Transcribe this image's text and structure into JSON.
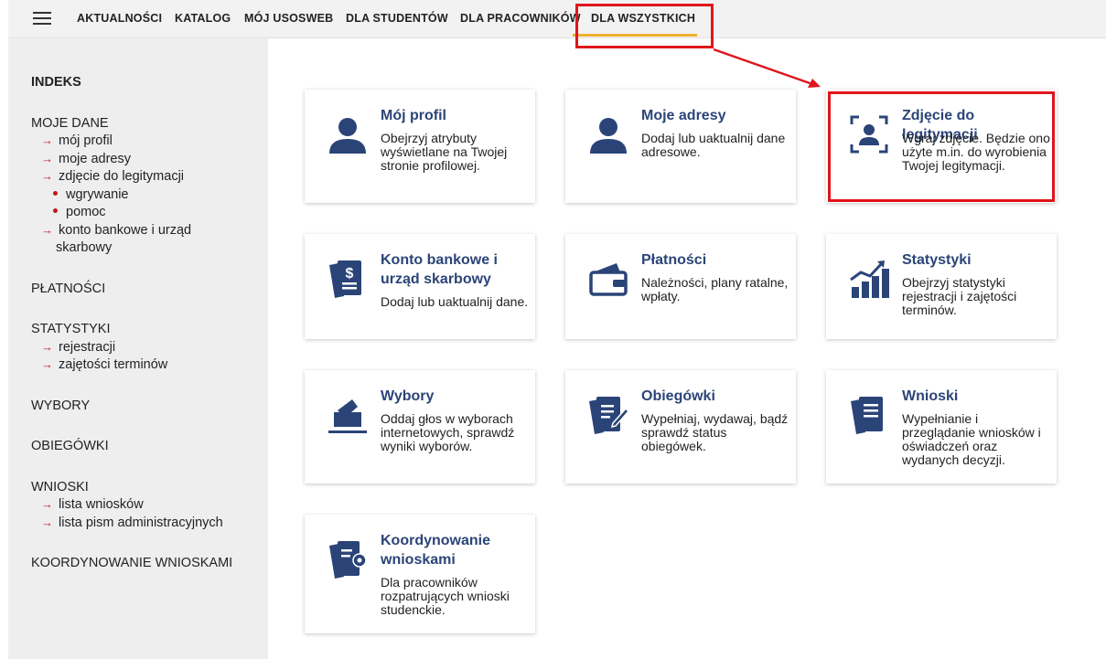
{
  "nav": {
    "items": [
      "AKTUALNOŚCI",
      "KATALOG",
      "MÓJ USOSWEB",
      "DLA STUDENTÓW",
      "DLA PRACOWNIKÓW",
      "DLA WSZYSTKICH"
    ]
  },
  "sidebar": {
    "indeks": "INDEKS",
    "moje_dane": "MOJE DANE",
    "moj_profil": "mój profil",
    "moje_adresy": "moje adresy",
    "zdjecie": "zdjęcie do legitymacji",
    "wgrywanie": "wgrywanie",
    "pomoc": "pomoc",
    "konto_1": "konto bankowe i urząd",
    "konto_2": "skarbowy",
    "platnosci": "PŁATNOŚCI",
    "statystyki": "STATYSTYKI",
    "rejestracji": "rejestracji",
    "zajetosci": "zajętości terminów",
    "wybory": "WYBORY",
    "obiegowki": "OBIEGÓWKI",
    "wnioski": "WNIOSKI",
    "lista_wnioskow": "lista wniosków",
    "lista_pism": "lista pism administracyjnych",
    "koordynowanie": "KOORDYNOWANIE WNIOSKAMI"
  },
  "cards": [
    {
      "title": "Mój profil",
      "desc": "Obejrzyj atrybuty wyświetlane na Twojej stronie profilowej.",
      "icon": "user-icon"
    },
    {
      "title": "Moje adresy",
      "desc": "Dodaj lub uaktualnij dane adresowe.",
      "icon": "user-icon"
    },
    {
      "title": "Zdjęcie do legitymacji",
      "desc": "Wgraj zdjęcie. Będzie ono użyte m.in. do wyrobienia Twojej legitymacji.",
      "icon": "id-photo-icon"
    },
    {
      "title": "Konto bankowe i urząd skarbowy",
      "desc": "Dodaj lub uaktualnij dane.",
      "icon": "bank-document-icon"
    },
    {
      "title": "Płatności",
      "desc": "Należności, plany ratalne, wpłaty.",
      "icon": "wallet-icon"
    },
    {
      "title": "Statystyki",
      "desc": "Obejrzyj statystyki rejestracji i zajętości terminów.",
      "icon": "chart-growth-icon"
    },
    {
      "title": "Wybory",
      "desc": "Oddaj głos w wyborach internetowych, sprawdź wyniki wyborów.",
      "icon": "ballot-box-icon"
    },
    {
      "title": "Obiegówki",
      "desc": "Wypełniaj, wydawaj, bądź sprawdź status obiegówek.",
      "icon": "document-edit-icon"
    },
    {
      "title": "Wnioski",
      "desc": "Wypełnianie i przeglądanie wniosków i oświadczeń oraz wydanych decyzji.",
      "icon": "document-stack-icon"
    },
    {
      "title": "Koordynowanie wnioskami",
      "desc": "Dla pracowników rozpatrujących wnioski studenckie.",
      "icon": "document-gear-icon"
    }
  ],
  "colors": {
    "accent": "#2b4478",
    "underline": "#f0b030",
    "highlight": "#e0151c",
    "sidebar_arrow": "#d02020"
  }
}
